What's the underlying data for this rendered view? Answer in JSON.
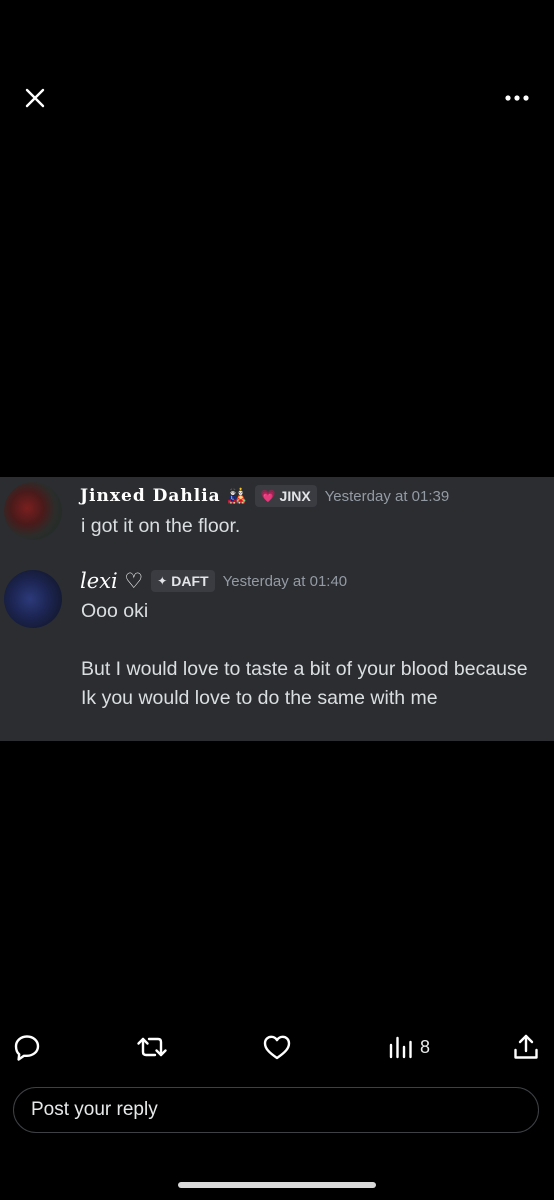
{
  "top_bar": {
    "close_icon": "close-icon",
    "more_icon": "more-horizontal-icon"
  },
  "media": {
    "messages": [
      {
        "username": "Jinxed Dahlia",
        "decoration": "🎎",
        "tag_icon": "💗",
        "tag": "JINX",
        "timestamp": "Yesterday at 01:39",
        "lines": [
          "i got it on the floor."
        ]
      },
      {
        "username": "lexi ♡",
        "tag_icon": "✦",
        "tag": "DAFT",
        "timestamp": "Yesterday at 01:40",
        "lines": [
          "Ooo oki",
          "But I would love to taste a bit of your blood because Ik you would love to do the same with me"
        ]
      }
    ]
  },
  "actions": {
    "reply_icon": "reply-icon",
    "repost_icon": "repost-icon",
    "like_icon": "heart-icon",
    "views_icon": "views-icon",
    "views_count": "8",
    "share_icon": "share-icon"
  },
  "reply": {
    "placeholder": "Post your reply"
  },
  "colors": {
    "background": "#000000",
    "media_background": "#2b2d31",
    "text": "#e7e9ea",
    "timestamp": "#949ba4",
    "tag_background": "#3a3c42"
  }
}
